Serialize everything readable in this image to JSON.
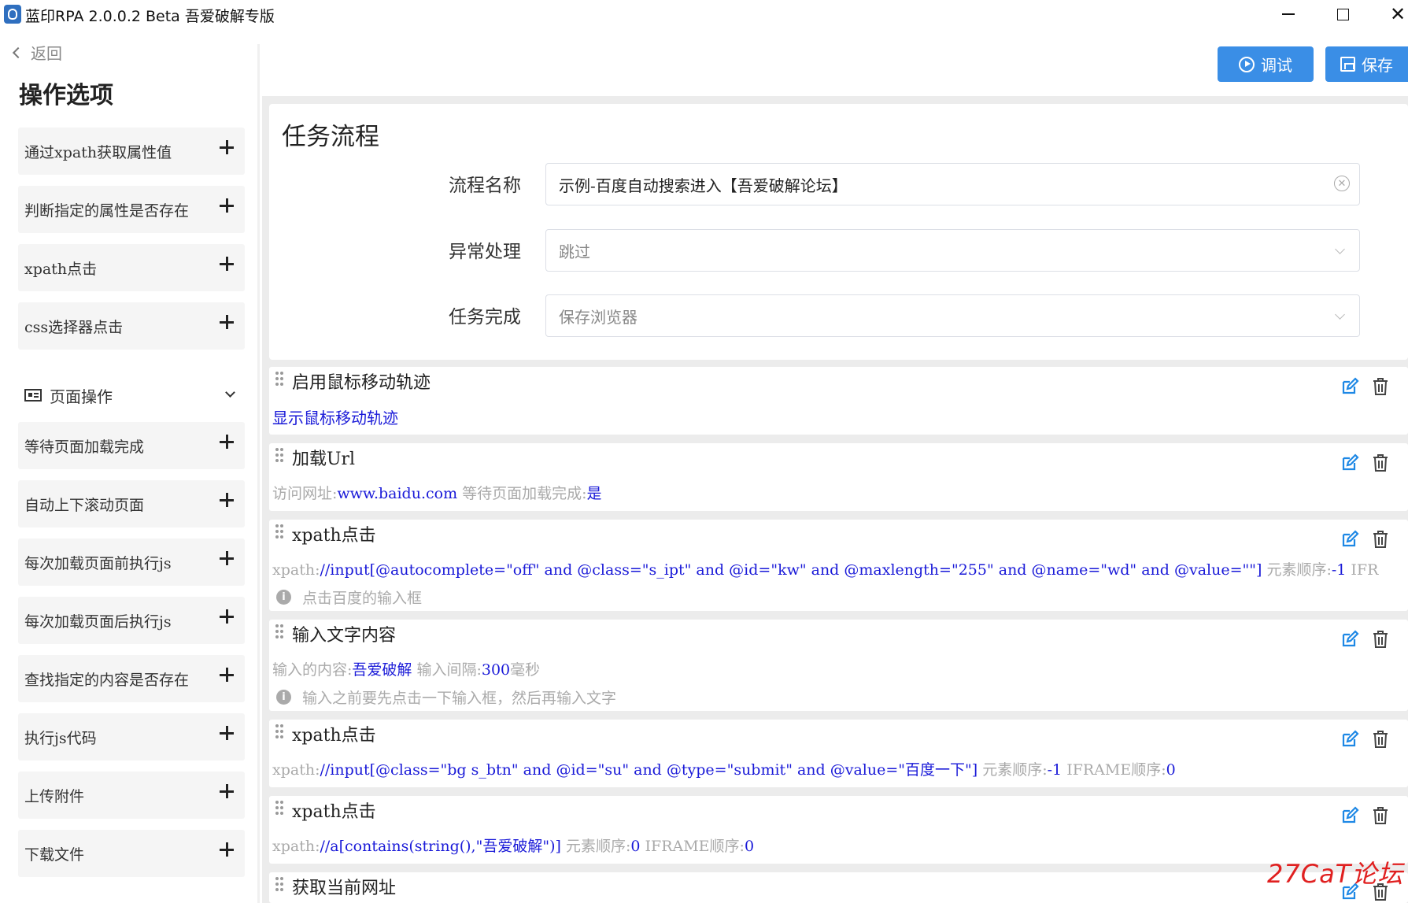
{
  "window": {
    "title": "蓝印RPA 2.0.0.2 Beta 吾爱破解专版",
    "close_glyph": "✕"
  },
  "sidebar": {
    "back_label": "返回",
    "title": "操作选项",
    "items_top": [
      "通过xpath获取属性值",
      "判断指定的属性是否存在",
      "xpath点击",
      "css选择器点击"
    ],
    "group_label": "页面操作",
    "items_group": [
      "等待页面加载完成",
      "自动上下滚动页面",
      "每次加载页面前执行js",
      "每次加载页面后执行js",
      "查找指定的内容是否存在",
      "执行js代码",
      "上传附件",
      "下载文件"
    ]
  },
  "toolbar": {
    "debug_label": "调试",
    "save_label": "保存",
    "accent": "#3a8ee6"
  },
  "main": {
    "title": "任务流程",
    "form": {
      "name_label": "流程名称",
      "name_value": "示例-百度自动搜索进入【吾爱破解论坛】",
      "error_label": "异常处理",
      "error_value": "跳过",
      "finish_label": "任务完成",
      "finish_value": "保存浏览器"
    }
  },
  "steps": [
    {
      "title": "启用鼠标移动轨迹",
      "link": "显示鼠标移动轨迹"
    },
    {
      "title": "加载Url",
      "k1": "访问网址:",
      "v1": "www.baidu.com",
      "k2": "等待页面加载完成:",
      "v2": "是"
    },
    {
      "title": "xpath点击",
      "k1": "xpath:",
      "v1": "//input[@autocomplete=\"off\" and @class=\"s_ipt\" and @id=\"kw\" and @maxlength=\"255\" and @name=\"wd\" and @value=\"\"]",
      "k2": "元素顺序:",
      "v2": "-1",
      "k3": "IFR",
      "note": "点击百度的输入框"
    },
    {
      "title": "输入文字内容",
      "k1": "输入的内容:",
      "v1": "吾爱破解",
      "k2": "输入间隔:",
      "v2": "300",
      "k3": "毫秒",
      "note": "输入之前要先点击一下输入框，然后再输入文字"
    },
    {
      "title": "xpath点击",
      "k1": "xpath:",
      "v1": "//input[@class=\"bg s_btn\" and @id=\"su\" and @type=\"submit\" and @value=\"百度一下\"]",
      "k2": "元素顺序:",
      "v2": "-1",
      "k3": "IFRAME顺序:",
      "v3": "0"
    },
    {
      "title": "xpath点击",
      "k1": "xpath:",
      "v1": "//a[contains(string(),\"吾爱破解\")]",
      "k2": "元素顺序:",
      "v2": "0",
      "k3": "IFRAME顺序:",
      "v3": "0"
    },
    {
      "title": "获取当前网址"
    }
  ],
  "watermark": "27CaT论坛",
  "colors": {
    "value_blue": "#1a1ad8",
    "icon_blue": "#1e88e5",
    "muted_gray": "#aaaaaa"
  }
}
